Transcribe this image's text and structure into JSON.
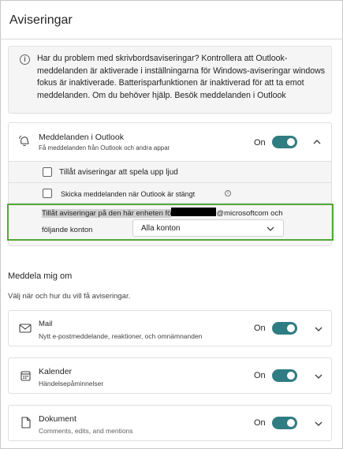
{
  "header": {
    "title": "Aviseringar"
  },
  "info": {
    "icon": "info-icon",
    "text": "Har du problem med skrivbordsaviseringar? Kontrollera att Outlook-meddelanden är aktiverade i inställningarna för Windows-aviseringar windows fokus är inaktiverade. Batterisparfunktionen är inaktiverad för att ta emot meddelanden. Om du behöver hjälp. Besök meddelanden i Outlook"
  },
  "outlook": {
    "icon": "bell-ringing-icon",
    "title": "Meddelanden i Outlook",
    "desc": "Få meddelanden från Outlook och andra appar",
    "state": "On",
    "options": [
      {
        "label": "Tillåt aviseringar att spela upp ljud",
        "checked": false
      },
      {
        "label": "Skicka meddelanden när Outlook är stängt",
        "checked": false
      }
    ],
    "device_text_selected": "Tillåt aviseringar på den här enheten fö",
    "device_text_domain": "@microsoftcom och",
    "device_text_line2": "följande konton",
    "accounts_value": "Alla konton"
  },
  "section": {
    "title": "Meddela mig om",
    "desc": "Välj när och hur du vill få aviseringar."
  },
  "categories": [
    {
      "icon": "mail-icon",
      "title": "Mail",
      "desc": "Nytt e-postmeddelande, reaktioner, och omnämnanden",
      "state": "On"
    },
    {
      "icon": "calendar-icon",
      "title": "Kalender",
      "desc": "Händelsepåminnelser",
      "state": "On"
    },
    {
      "icon": "document-icon",
      "title": "Dokument",
      "desc": "Comments, edits, and mentions",
      "state": "On"
    }
  ],
  "colors": {
    "toggle": "#2f7d82",
    "highlight": "#52a83a"
  }
}
